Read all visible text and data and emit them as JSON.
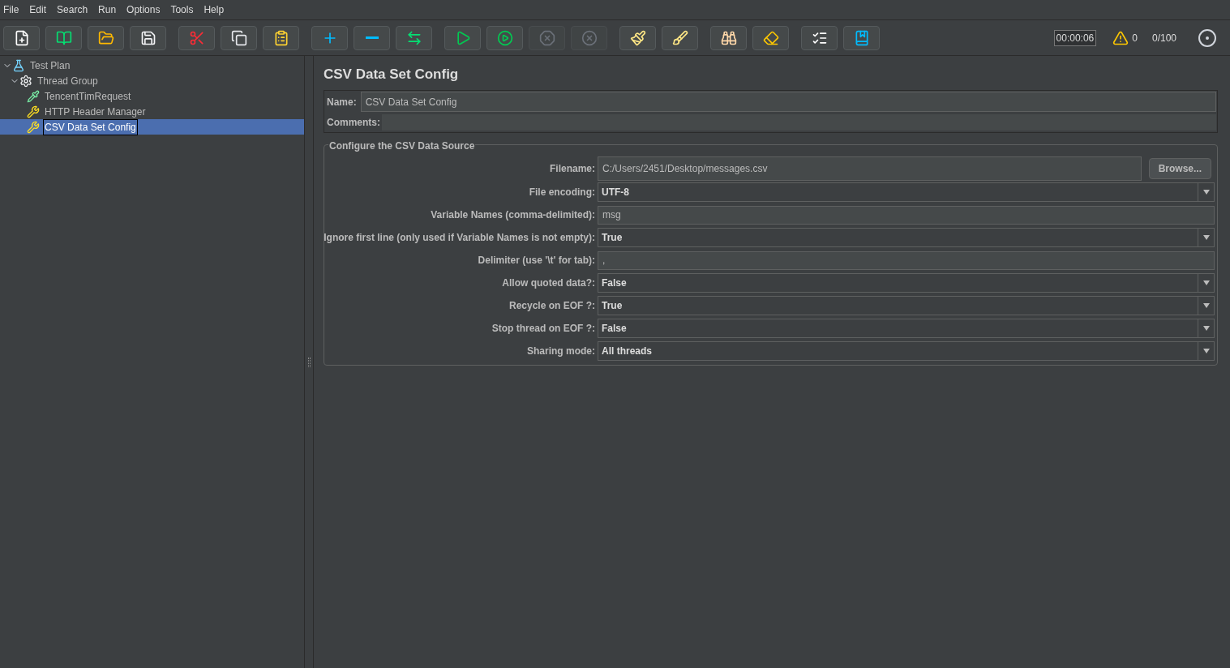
{
  "menu": [
    {
      "label": "File"
    },
    {
      "label": "Edit"
    },
    {
      "label": "Search"
    },
    {
      "label": "Run"
    },
    {
      "label": "Options"
    },
    {
      "label": "Tools"
    },
    {
      "label": "Help"
    }
  ],
  "toolbar": [
    [
      {
        "kind": "new",
        "disabled": false
      },
      {
        "kind": "templates",
        "disabled": false
      },
      {
        "kind": "open",
        "disabled": false
      },
      {
        "kind": "save",
        "disabled": false
      }
    ],
    [
      {
        "kind": "cut",
        "disabled": false
      },
      {
        "kind": "copy",
        "disabled": false
      },
      {
        "kind": "paste",
        "disabled": false
      }
    ],
    [
      {
        "kind": "expand",
        "disabled": false
      },
      {
        "kind": "collapse",
        "disabled": false
      },
      {
        "kind": "toggle",
        "disabled": false
      }
    ],
    [
      {
        "kind": "start",
        "disabled": false
      },
      {
        "kind": "start-no-timers",
        "disabled": false
      },
      {
        "kind": "stop",
        "disabled": true
      },
      {
        "kind": "shutdown",
        "disabled": true
      }
    ],
    [
      {
        "kind": "clear",
        "disabled": false
      },
      {
        "kind": "clear-all",
        "disabled": false
      }
    ],
    [
      {
        "kind": "search",
        "disabled": false
      },
      {
        "kind": "reset-search",
        "disabled": false
      }
    ],
    [
      {
        "kind": "function-helper",
        "disabled": false
      },
      {
        "kind": "help",
        "disabled": false
      }
    ]
  ],
  "status": {
    "timer": "00:00:06",
    "warnings": "0",
    "threads": "0/100"
  },
  "tree": [
    {
      "label": "Test Plan",
      "kind": "plan",
      "expanded": true,
      "selected": false,
      "children": [
        {
          "label": "Thread Group",
          "kind": "thread-group",
          "expanded": true,
          "selected": false,
          "children": [
            {
              "label": "TencentTimRequest",
              "kind": "sampler",
              "selected": false
            },
            {
              "label": "HTTP Header Manager",
              "kind": "config",
              "selected": false
            },
            {
              "label": "CSV Data Set Config",
              "kind": "config",
              "selected": true
            }
          ]
        }
      ]
    }
  ],
  "panel": {
    "title": "CSV Data Set Config",
    "name_label": "Name:",
    "name_value": "CSV Data Set Config",
    "comments_label": "Comments:",
    "group_title": "Configure the CSV Data Source",
    "browse": "Browse...",
    "fields": [
      {
        "label": "Filename:",
        "value": "C:/Users/2451/Desktop/messages.csv",
        "kind": "file"
      },
      {
        "label": "File encoding:",
        "value": "UTF-8",
        "kind": "select"
      },
      {
        "label": "Variable Names (comma-delimited):",
        "value": "msg",
        "kind": "text"
      },
      {
        "label": "Ignore first line (only used if Variable Names is not empty):",
        "value": "True",
        "kind": "select"
      },
      {
        "label": "Delimiter (use '\\t' for tab):",
        "value": ",",
        "kind": "text"
      },
      {
        "label": "Allow quoted data?:",
        "value": "False",
        "kind": "select"
      },
      {
        "label": "Recycle on EOF ?:",
        "value": "True",
        "kind": "select"
      },
      {
        "label": "Stop thread on EOF ?:",
        "value": "False",
        "kind": "select"
      },
      {
        "label": "Sharing mode:",
        "value": "All threads",
        "kind": "select"
      }
    ]
  }
}
